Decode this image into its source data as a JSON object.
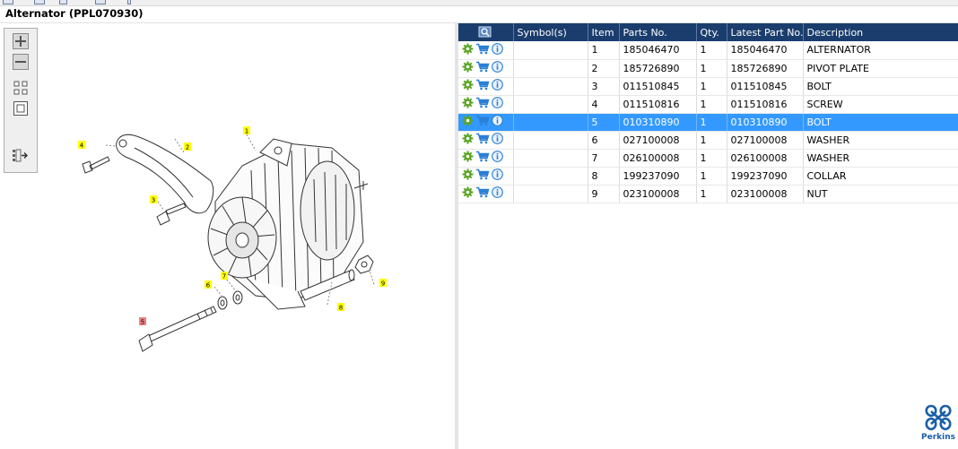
{
  "window": {
    "title": "Alternator (PPL070930)"
  },
  "colors": {
    "header": "#1a3d6d",
    "selected_row": "#3399ff",
    "gear": "#5aa524",
    "cart": "#2a7fd4",
    "info": "#2a7fd4",
    "callout": "#ffff00",
    "callout_selected": "#f08080"
  },
  "toolbar": {
    "buttons": [
      {
        "name": "zoom-in",
        "icon": "plus-icon"
      },
      {
        "name": "zoom-out",
        "icon": "minus-icon"
      },
      {
        "name": "fit-all",
        "icon": "fit-all-icon"
      },
      {
        "name": "fit-window",
        "icon": "fit-window-icon"
      },
      {
        "name": "export",
        "icon": "list-arrow-icon"
      }
    ]
  },
  "diagram": {
    "callouts": [
      "1",
      "2",
      "3",
      "4",
      "5",
      "6",
      "7",
      "8",
      "9"
    ],
    "selected_callout": "5"
  },
  "table": {
    "columns": [
      "",
      "Symbol(s)",
      "Item",
      "Parts No.",
      "Qty.",
      "Latest Part No.",
      "Description"
    ],
    "rows": [
      {
        "item": "1",
        "part": "185046470",
        "qty": "1",
        "latest": "185046470",
        "desc": "ALTERNATOR"
      },
      {
        "item": "2",
        "part": "185726890",
        "qty": "1",
        "latest": "185726890",
        "desc": "PIVOT PLATE"
      },
      {
        "item": "3",
        "part": "011510845",
        "qty": "1",
        "latest": "011510845",
        "desc": "BOLT"
      },
      {
        "item": "4",
        "part": "011510816",
        "qty": "1",
        "latest": "011510816",
        "desc": "SCREW"
      },
      {
        "item": "5",
        "part": "010310890",
        "qty": "1",
        "latest": "010310890",
        "desc": "BOLT"
      },
      {
        "item": "6",
        "part": "027100008",
        "qty": "1",
        "latest": "027100008",
        "desc": "WASHER"
      },
      {
        "item": "7",
        "part": "026100008",
        "qty": "1",
        "latest": "026100008",
        "desc": "WASHER"
      },
      {
        "item": "8",
        "part": "199237090",
        "qty": "1",
        "latest": "199237090",
        "desc": "COLLAR"
      },
      {
        "item": "9",
        "part": "023100008",
        "qty": "1",
        "latest": "023100008",
        "desc": "NUT"
      }
    ],
    "selected_item": "5"
  },
  "logo": {
    "text": "Perkins"
  }
}
